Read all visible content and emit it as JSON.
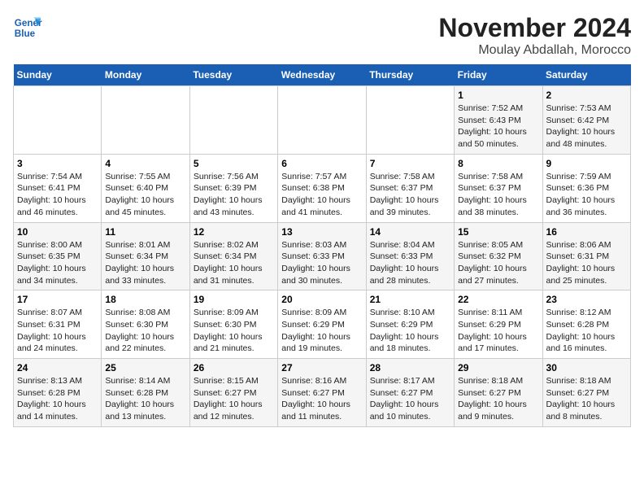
{
  "logo": {
    "line1": "General",
    "line2": "Blue"
  },
  "title": "November 2024",
  "subtitle": "Moulay Abdallah, Morocco",
  "days_of_week": [
    "Sunday",
    "Monday",
    "Tuesday",
    "Wednesday",
    "Thursday",
    "Friday",
    "Saturday"
  ],
  "weeks": [
    [
      {
        "day": "",
        "info": ""
      },
      {
        "day": "",
        "info": ""
      },
      {
        "day": "",
        "info": ""
      },
      {
        "day": "",
        "info": ""
      },
      {
        "day": "",
        "info": ""
      },
      {
        "day": "1",
        "info": "Sunrise: 7:52 AM\nSunset: 6:43 PM\nDaylight: 10 hours and 50 minutes."
      },
      {
        "day": "2",
        "info": "Sunrise: 7:53 AM\nSunset: 6:42 PM\nDaylight: 10 hours and 48 minutes."
      }
    ],
    [
      {
        "day": "3",
        "info": "Sunrise: 7:54 AM\nSunset: 6:41 PM\nDaylight: 10 hours and 46 minutes."
      },
      {
        "day": "4",
        "info": "Sunrise: 7:55 AM\nSunset: 6:40 PM\nDaylight: 10 hours and 45 minutes."
      },
      {
        "day": "5",
        "info": "Sunrise: 7:56 AM\nSunset: 6:39 PM\nDaylight: 10 hours and 43 minutes."
      },
      {
        "day": "6",
        "info": "Sunrise: 7:57 AM\nSunset: 6:38 PM\nDaylight: 10 hours and 41 minutes."
      },
      {
        "day": "7",
        "info": "Sunrise: 7:58 AM\nSunset: 6:37 PM\nDaylight: 10 hours and 39 minutes."
      },
      {
        "day": "8",
        "info": "Sunrise: 7:58 AM\nSunset: 6:37 PM\nDaylight: 10 hours and 38 minutes."
      },
      {
        "day": "9",
        "info": "Sunrise: 7:59 AM\nSunset: 6:36 PM\nDaylight: 10 hours and 36 minutes."
      }
    ],
    [
      {
        "day": "10",
        "info": "Sunrise: 8:00 AM\nSunset: 6:35 PM\nDaylight: 10 hours and 34 minutes."
      },
      {
        "day": "11",
        "info": "Sunrise: 8:01 AM\nSunset: 6:34 PM\nDaylight: 10 hours and 33 minutes."
      },
      {
        "day": "12",
        "info": "Sunrise: 8:02 AM\nSunset: 6:34 PM\nDaylight: 10 hours and 31 minutes."
      },
      {
        "day": "13",
        "info": "Sunrise: 8:03 AM\nSunset: 6:33 PM\nDaylight: 10 hours and 30 minutes."
      },
      {
        "day": "14",
        "info": "Sunrise: 8:04 AM\nSunset: 6:33 PM\nDaylight: 10 hours and 28 minutes."
      },
      {
        "day": "15",
        "info": "Sunrise: 8:05 AM\nSunset: 6:32 PM\nDaylight: 10 hours and 27 minutes."
      },
      {
        "day": "16",
        "info": "Sunrise: 8:06 AM\nSunset: 6:31 PM\nDaylight: 10 hours and 25 minutes."
      }
    ],
    [
      {
        "day": "17",
        "info": "Sunrise: 8:07 AM\nSunset: 6:31 PM\nDaylight: 10 hours and 24 minutes."
      },
      {
        "day": "18",
        "info": "Sunrise: 8:08 AM\nSunset: 6:30 PM\nDaylight: 10 hours and 22 minutes."
      },
      {
        "day": "19",
        "info": "Sunrise: 8:09 AM\nSunset: 6:30 PM\nDaylight: 10 hours and 21 minutes."
      },
      {
        "day": "20",
        "info": "Sunrise: 8:09 AM\nSunset: 6:29 PM\nDaylight: 10 hours and 19 minutes."
      },
      {
        "day": "21",
        "info": "Sunrise: 8:10 AM\nSunset: 6:29 PM\nDaylight: 10 hours and 18 minutes."
      },
      {
        "day": "22",
        "info": "Sunrise: 8:11 AM\nSunset: 6:29 PM\nDaylight: 10 hours and 17 minutes."
      },
      {
        "day": "23",
        "info": "Sunrise: 8:12 AM\nSunset: 6:28 PM\nDaylight: 10 hours and 16 minutes."
      }
    ],
    [
      {
        "day": "24",
        "info": "Sunrise: 8:13 AM\nSunset: 6:28 PM\nDaylight: 10 hours and 14 minutes."
      },
      {
        "day": "25",
        "info": "Sunrise: 8:14 AM\nSunset: 6:28 PM\nDaylight: 10 hours and 13 minutes."
      },
      {
        "day": "26",
        "info": "Sunrise: 8:15 AM\nSunset: 6:27 PM\nDaylight: 10 hours and 12 minutes."
      },
      {
        "day": "27",
        "info": "Sunrise: 8:16 AM\nSunset: 6:27 PM\nDaylight: 10 hours and 11 minutes."
      },
      {
        "day": "28",
        "info": "Sunrise: 8:17 AM\nSunset: 6:27 PM\nDaylight: 10 hours and 10 minutes."
      },
      {
        "day": "29",
        "info": "Sunrise: 8:18 AM\nSunset: 6:27 PM\nDaylight: 10 hours and 9 minutes."
      },
      {
        "day": "30",
        "info": "Sunrise: 8:18 AM\nSunset: 6:27 PM\nDaylight: 10 hours and 8 minutes."
      }
    ]
  ]
}
